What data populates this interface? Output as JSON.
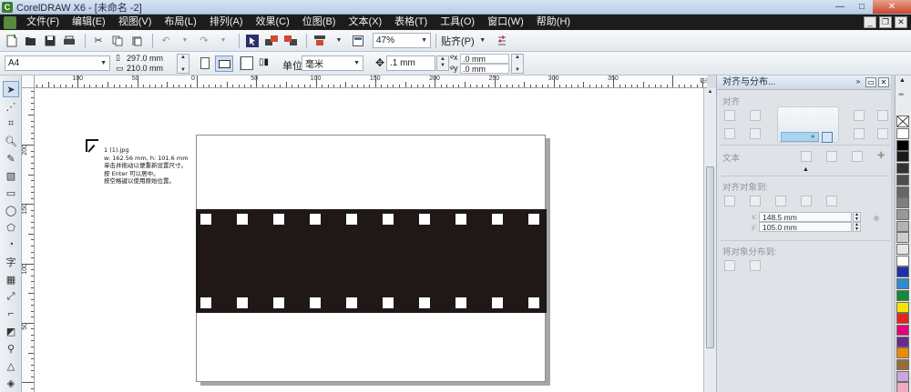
{
  "titlebar": {
    "title": "CorelDRAW X6 - [未命名 -2]",
    "minimize": "—",
    "maximize": "□",
    "close": "✕"
  },
  "menubar": {
    "items": [
      "文件(F)",
      "编辑(E)",
      "视图(V)",
      "布局(L)",
      "排列(A)",
      "效果(C)",
      "位图(B)",
      "文本(X)",
      "表格(T)",
      "工具(O)",
      "窗口(W)",
      "帮助(H)"
    ]
  },
  "stdbar": {
    "zoom": "47%",
    "snap": "贴齐(P)"
  },
  "propbar": {
    "page_size": "A4",
    "width": "297.0 mm",
    "height": "210.0 mm",
    "units_label": "单位:",
    "units_value": "毫米",
    "nudge": ".1 mm",
    "dup_x": ".0 mm",
    "dup_y": ".0 mm"
  },
  "ruler": {
    "top_labels": [
      "100",
      "50",
      "0",
      "50",
      "100",
      "150",
      "200",
      "250",
      "300",
      "350"
    ],
    "left_labels": [
      "200",
      "150",
      "100",
      "50"
    ],
    "unit": "毫米"
  },
  "import_info": {
    "filename": "1 (1).jpg",
    "dims": "w: 162.56 mm, h: 101.6 mm",
    "line1": "单击并拖动以便重新设置尺寸。",
    "line2": "按 Enter 可以居中。",
    "line3": "按空格键以使用原始位置。"
  },
  "docker": {
    "title": "对齐与分布...",
    "align_label": "对齐",
    "text_label": "文本",
    "align_to_label": "对齐对象到:",
    "x_value": "148.5 mm",
    "y_value": "105.0 mm",
    "x_label": "x:",
    "y_label": "y:",
    "distribute_label": "将对象分布到:"
  },
  "palette": {
    "colors": [
      "#ffffff",
      "#000000",
      "#1a1a1a",
      "#333333",
      "#4d4d4d",
      "#666666",
      "#808080",
      "#999999",
      "#b3b3b3",
      "#cccccc",
      "#e6e6e6",
      "#ffffff",
      "#1f2fa8",
      "#2e8bcf",
      "#138a3c",
      "#f4e600",
      "#e52420",
      "#e2007a",
      "#6b2a8a",
      "#f08a00",
      "#9a6b3a",
      "#c9a7d9",
      "#f2a9c3"
    ]
  }
}
